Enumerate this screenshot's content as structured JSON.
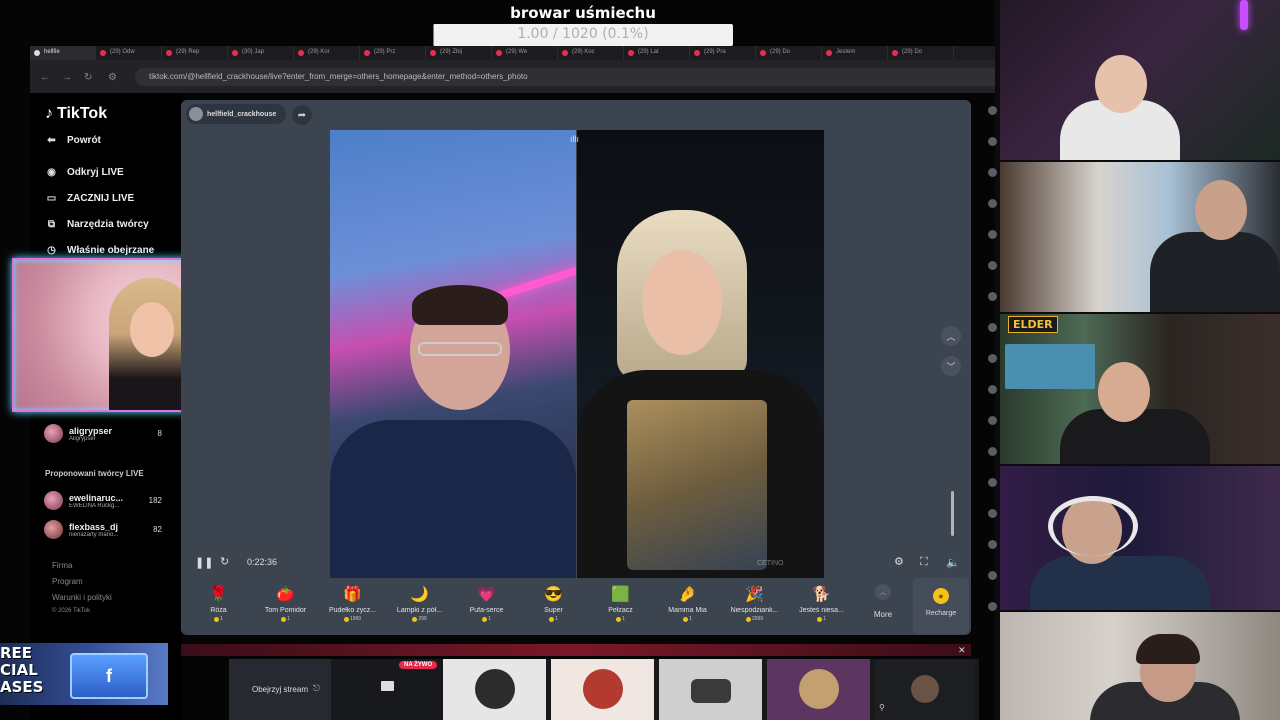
{
  "goal": {
    "title": "browar uśmiechu",
    "progress_text": "1.00 / 1020 (0.1%)",
    "percent": 0.1
  },
  "browser": {
    "tabs": [
      "hellfie",
      "(29) Odw",
      "(29) Rep",
      "(30) Jap",
      "(29) Kor",
      "(29) Prz",
      "(29) Zbij",
      "(29) We",
      "(29) Koc",
      "(29) Lat",
      "(29) Pra",
      "(29) Do",
      "Jestem",
      "(29) Do"
    ],
    "url": "tiktok.com/@hellfield_crackhouse/live?enter_from_merge=others_homepage&enter_method=others_photo"
  },
  "sidebar": {
    "logo": "TikTok",
    "items": [
      {
        "label": "Powrót",
        "icon": "arrow-left-icon"
      },
      {
        "label": "Odkryj LIVE",
        "icon": "live-discover-icon"
      },
      {
        "label": "ZACZNIJ LIVE",
        "icon": "camera-icon"
      },
      {
        "label": "Narzędzia twórcy",
        "icon": "tools-icon"
      },
      {
        "label": "Właśnie obejrzane",
        "icon": "clock-icon"
      }
    ],
    "followed": {
      "name": "aligrypser",
      "sub": "Aligrypser",
      "count": "8"
    },
    "suggested_title": "Proponowani twórcy LIVE",
    "suggested": [
      {
        "name": "ewelinaruc...",
        "sub": "EWELINA Ruckg...",
        "count": "182"
      },
      {
        "name": "flexbass_dj",
        "sub": "nienażarty mario...",
        "count": "82"
      }
    ],
    "footer": [
      "Firma",
      "Program",
      "Warunki i polityki",
      "© 2026 TikTok"
    ]
  },
  "live": {
    "host": "hellfield_crackhouse",
    "time": "0:22:36",
    "watermark": "CETINO",
    "gifts": [
      {
        "name": "Róża",
        "price": "1",
        "icon": "🌹"
      },
      {
        "name": "Tom Pomidor",
        "price": "1",
        "icon": "🍅"
      },
      {
        "name": "Pudełko życz...",
        "price": "1999",
        "icon": "🎁"
      },
      {
        "name": "Lampki z pół...",
        "price": "299",
        "icon": "🌙"
      },
      {
        "name": "Pufa-serce",
        "price": "1",
        "icon": "💗"
      },
      {
        "name": "Super",
        "price": "1",
        "icon": "😎"
      },
      {
        "name": "Pełzacz",
        "price": "1",
        "icon": "🟩"
      },
      {
        "name": "Mamma Mia",
        "price": "1",
        "icon": "🤌"
      },
      {
        "name": "Niespodziank...",
        "price": "2999",
        "icon": "🎉"
      },
      {
        "name": "Jesteś niesa...",
        "price": "1",
        "icon": "🐕"
      }
    ],
    "more_label": "More",
    "recharge_label": "Recharge",
    "bottom": {
      "watch_label": "Obejrzyj stream",
      "live_badge": "NA ŻYWO"
    }
  },
  "promo": {
    "text": "REE\nCIAL\nASES"
  },
  "cams": {
    "tag": "ELDER"
  },
  "colors": {
    "panel": "#3c4450",
    "accent_pink": "#e8294e",
    "coin": "#f3c11a",
    "webcam_border": "#e46cf0"
  }
}
